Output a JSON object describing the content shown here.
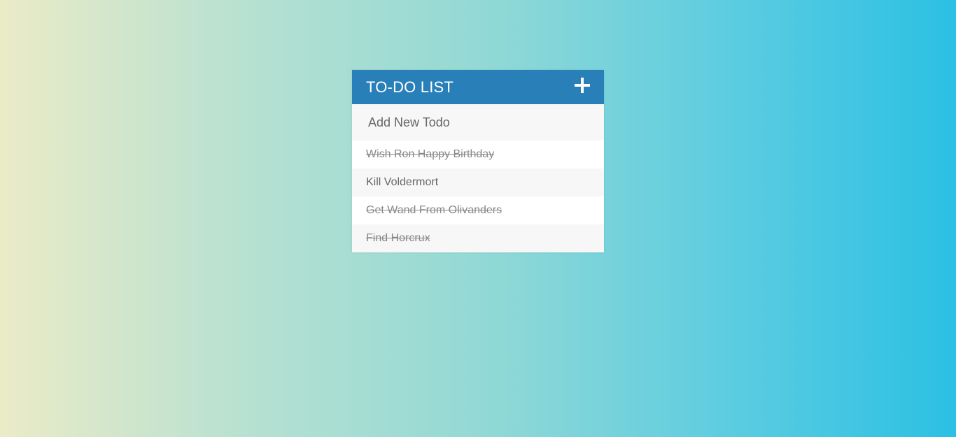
{
  "header": {
    "title": "TO-DO LIST",
    "add_icon": "plus-icon"
  },
  "input": {
    "placeholder": "Add New Todo",
    "value": ""
  },
  "todos": [
    {
      "text": "Wish Ron Happy Birthday",
      "completed": true
    },
    {
      "text": "Kill Voldermort",
      "completed": false
    },
    {
      "text": "Get Wand From Olivanders",
      "completed": true
    },
    {
      "text": "Find Horcrux",
      "completed": true
    }
  ],
  "colors": {
    "header": "#2980b9",
    "gradient_start": "#ebebc7",
    "gradient_end": "#2bc0e4"
  }
}
